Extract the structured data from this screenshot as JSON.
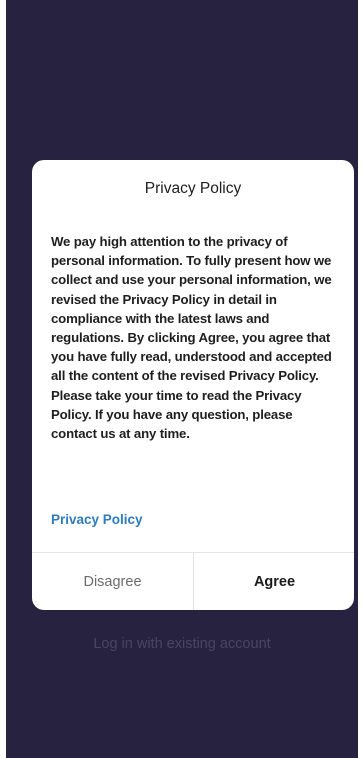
{
  "background": {
    "login_link": "Log in with existing account"
  },
  "dialog": {
    "title": "Privacy Policy",
    "body": "We pay high attention to the privacy of personal information. To fully present how we collect and use your personal information, we revised the Privacy Policy in detail in compliance with the latest laws and regulations. By clicking Agree, you agree that you have fully read, understood and accepted all the content of the revised Privacy Policy. Please take your time to read the Privacy Policy. If you have any question, please contact us at any time.",
    "policy_link": "Privacy Policy",
    "disagree_label": "Disagree",
    "agree_label": "Agree"
  },
  "colors": {
    "background": "#27223f",
    "link": "#2f7bbf",
    "dialog": "#ffffff"
  }
}
